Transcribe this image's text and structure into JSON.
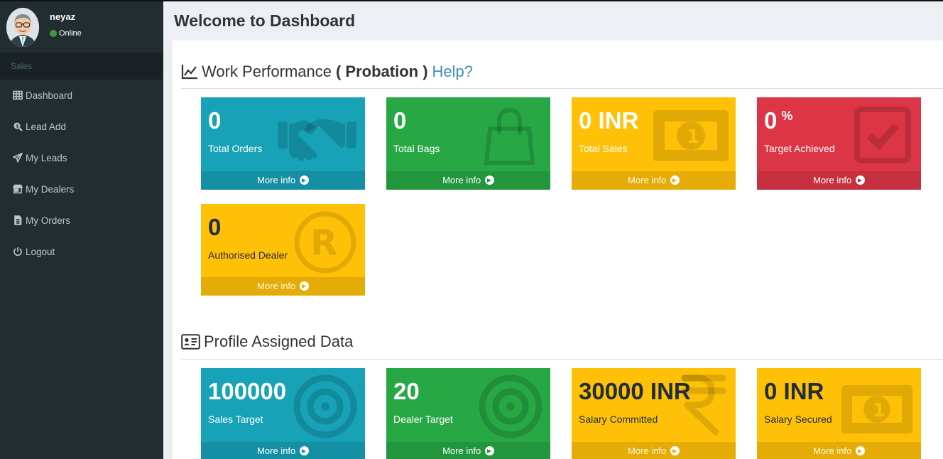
{
  "user": {
    "name": "neyaz",
    "status": "Online"
  },
  "sidebar": {
    "section": "Sales",
    "items": [
      {
        "label": "Dashboard",
        "icon": "table-icon"
      },
      {
        "label": "Lead Add",
        "icon": "search-dollar-icon"
      },
      {
        "label": "My Leads",
        "icon": "paper-plane-icon"
      },
      {
        "label": "My Dealers",
        "icon": "store-icon"
      },
      {
        "label": "My Orders",
        "icon": "file-icon"
      },
      {
        "label": "Logout",
        "icon": "power-icon"
      }
    ]
  },
  "page": {
    "title": "Welcome to Dashboard"
  },
  "work_performance": {
    "title": "Work Performance",
    "status": "( Probation )",
    "help": "Help?",
    "cards": [
      {
        "value": "0",
        "label": "Total Orders",
        "footer": "More info",
        "icon": "handshake-icon"
      },
      {
        "value": "0",
        "label": "Total Bags",
        "footer": "More info",
        "icon": "shopping-bag-icon"
      },
      {
        "value": "0 INR",
        "label": "Total Sales",
        "footer": "More info",
        "icon": "money-bill-icon"
      },
      {
        "value": "0",
        "unit": "%",
        "label": "Target Achieved",
        "footer": "More info",
        "icon": "check-square-icon"
      },
      {
        "value": "0",
        "label": "Authorised Dealer",
        "footer": "More info",
        "icon": "registered-icon"
      }
    ]
  },
  "profile": {
    "title": "Profile Assigned Data",
    "cards": [
      {
        "value": "100000",
        "label": "Sales Target",
        "footer": "More info",
        "icon": "bullseye-icon"
      },
      {
        "value": "20",
        "label": "Dealer Target",
        "footer": "More info",
        "icon": "bullseye-icon"
      },
      {
        "value": "30000 INR",
        "label": "Salary Committed",
        "footer": "More info",
        "icon": "rupee-icon"
      },
      {
        "value": "0 INR",
        "label": "Salary Secured",
        "footer": "More info",
        "icon": "money-bill-icon"
      }
    ]
  },
  "colors": {
    "aqua": "#17a2b8",
    "green": "#28a745",
    "yellow": "#ffc107",
    "red": "#dc3545",
    "sidebar": "#222d32",
    "link": "#3c8dbc"
  }
}
